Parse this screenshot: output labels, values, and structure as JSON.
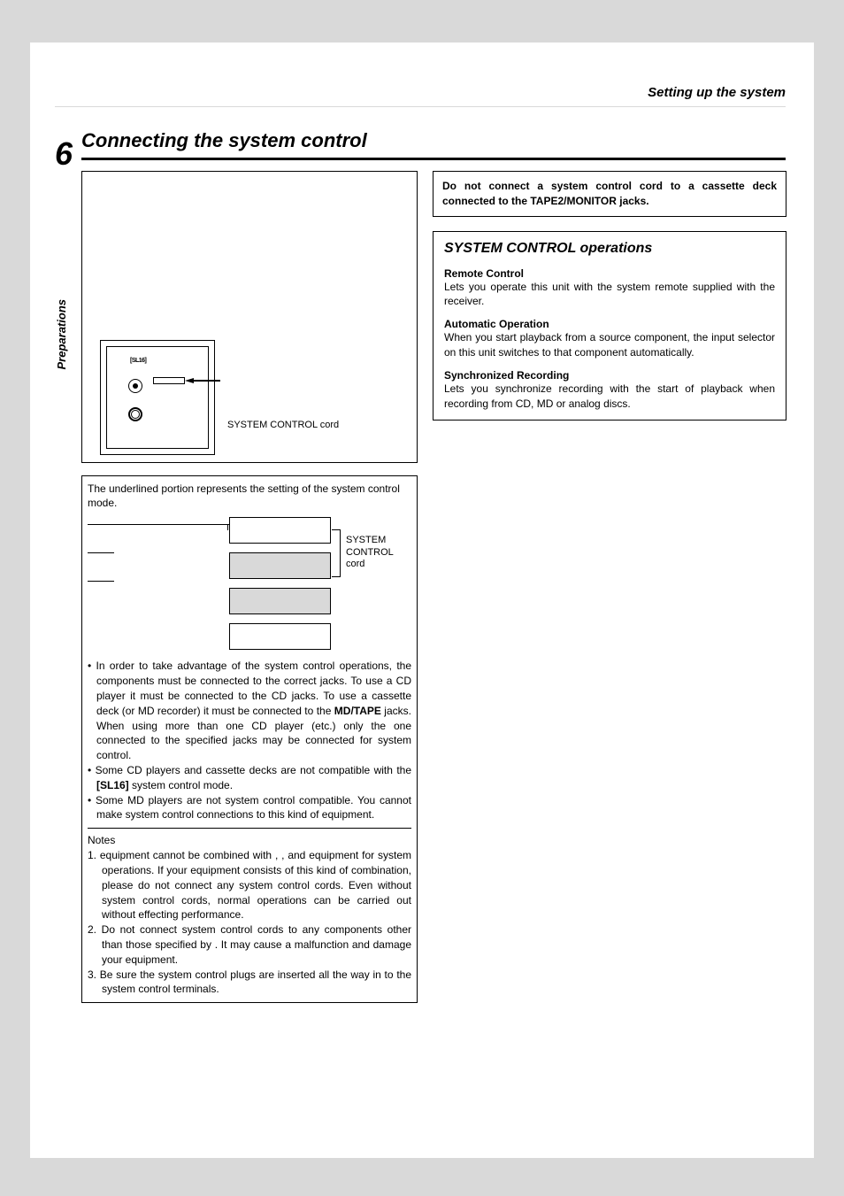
{
  "breadcrumb": "Setting up the system",
  "page_number": "6",
  "section_label": "Preparations",
  "main_heading": "Connecting the system control",
  "figure1": {
    "sl16": "[SL16]",
    "cord_label": "SYSTEM CONTROL cord"
  },
  "figure_desc": "The underlined portion represents the setting of the system control mode.",
  "diagram": {
    "cord_label": "SYSTEM CONTROL cord"
  },
  "bullets": {
    "b1_pre": "• In order to take advantage of the system control operations, the components must be connected to the correct jacks. To use a CD player it must be connected to the CD jacks. To use a cassette deck (or MD recorder) it must be connected to the ",
    "b1_bold": "MD/TAPE",
    "b1_post": " jacks. When using more than one CD player (etc.) only the one connected to the specified jacks may be connected for system control.",
    "b2_pre": "• Some CD players and cassette decks are not compatible with the ",
    "b2_bold": "[SL16]",
    "b2_post": " system control mode.",
    "b3": "• Some MD players are not system control compatible. You cannot make system control connections to this kind of equipment."
  },
  "notes_heading": "Notes",
  "notes": {
    "n1": "1.          equipment cannot be combined with        ,        , and           equipment for system operations. If your equipment consists of this kind of combination, please do not connect any system control cords. Even without system control cords, normal operations can be carried out without effecting performance.",
    "n2": "2. Do not connect system control cords to any components other than those specified by                  . It may cause a malfunction and damage your equipment.",
    "n3": "3. Be sure the system control plugs are inserted all the way in to the system control terminals."
  },
  "warning": "Do not connect a system control cord to a cassette deck connected to the TAPE2/MONITOR jacks.",
  "ops": {
    "heading": "SYSTEM CONTROL operations",
    "remote_head": "Remote Control",
    "remote_body": "Lets you operate this unit with the system remote supplied with the receiver.",
    "auto_head": "Automatic Operation",
    "auto_body": "When you start playback from a source component, the input selector on this unit switches to that component automatically.",
    "sync_head": "Synchronized Recording",
    "sync_body": "Lets you synchronize recording with the start of playback when recording from CD, MD or analog discs."
  }
}
